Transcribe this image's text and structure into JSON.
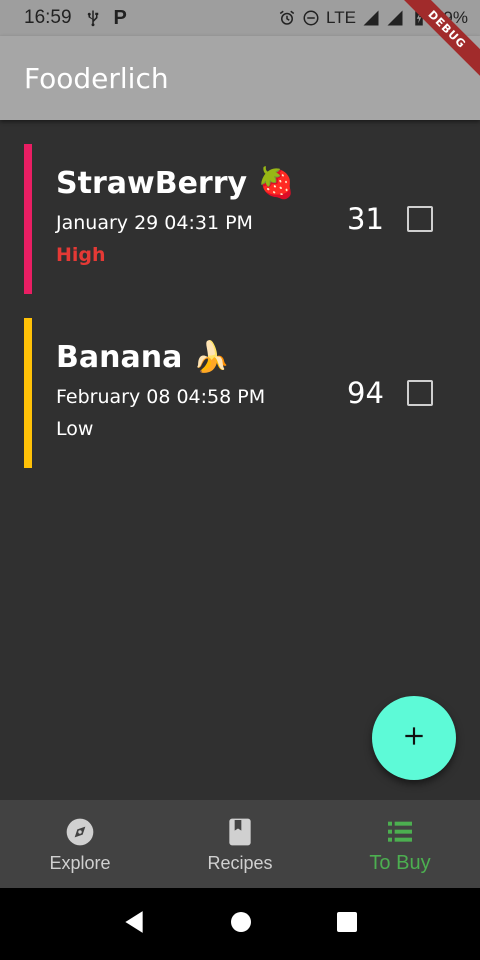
{
  "status_bar": {
    "time": "16:59",
    "network": "LTE",
    "battery": "79%",
    "icons": [
      "usb-icon",
      "p-icon",
      "alarm-icon",
      "do-not-disturb-icon",
      "signal-icon",
      "battery-charging-icon"
    ]
  },
  "app_bar": {
    "title": "Fooderlich"
  },
  "debug_banner": {
    "label": "DEBUG",
    "color": "#a12b2b"
  },
  "grocery_items": [
    {
      "name": "StrawBerry 🍓",
      "date": "January 29 04:31 PM",
      "importance": "High",
      "quantity": "31",
      "checked": false,
      "color": "#e91e63"
    },
    {
      "name": "Banana 🍌",
      "date": "February 08 04:58 PM",
      "importance": "Low",
      "quantity": "94",
      "checked": false,
      "color": "#ffc107"
    }
  ],
  "fab": {
    "icon": "add-icon",
    "color": "#5dfad7"
  },
  "bottom_nav": {
    "items": [
      {
        "label": "Explore",
        "icon": "explore-icon",
        "active": false
      },
      {
        "label": "Recipes",
        "icon": "book-icon",
        "active": false
      },
      {
        "label": "To Buy",
        "icon": "list-icon",
        "active": true
      }
    ],
    "active_color": "#4caf50"
  },
  "system_nav": {
    "icons": [
      "back-icon",
      "home-icon",
      "recents-icon"
    ]
  }
}
